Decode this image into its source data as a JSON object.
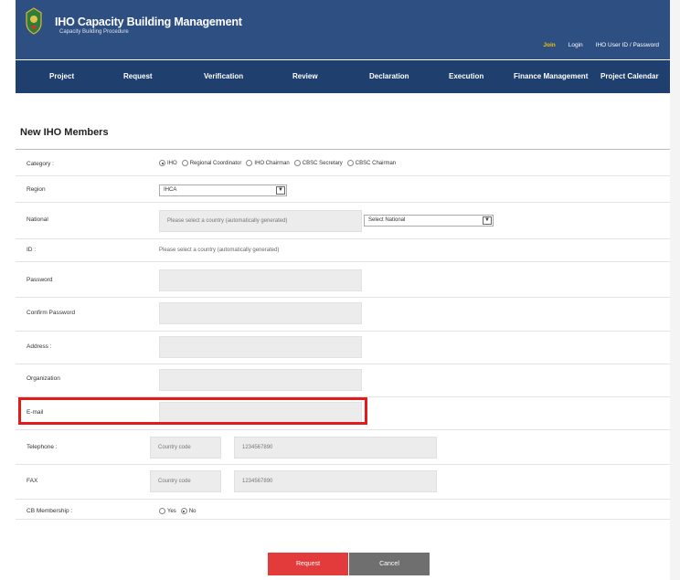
{
  "header": {
    "title": "IHO Capacity Building Management",
    "subtitle": "Capacity Building Procedure",
    "links": [
      "Join",
      "Login",
      "IHO User ID / Password"
    ]
  },
  "nav": {
    "items": [
      "Project",
      "Request",
      "Verification",
      "Review",
      "Declaration",
      "Execution",
      "Finance Management",
      "Project Calendar"
    ]
  },
  "form": {
    "title": "New IHO Members",
    "category": {
      "label": "Category :",
      "options": [
        "IHO",
        "Regional Coordinator",
        "IHO Chairman",
        "CBSC Secretary",
        "CBSC Chairman"
      ],
      "selected": "IHO"
    },
    "region": {
      "label": "Region",
      "value": "IHCA"
    },
    "national": {
      "label": "National",
      "placeholder": "Please select a country (automatically generated)",
      "select": "Select National"
    },
    "id": {
      "label": "ID :",
      "text": "Please select a country (automatically generated)"
    },
    "password": {
      "label": "Password"
    },
    "confirm_password": {
      "label": "Confirm Password"
    },
    "address": {
      "label": "Address :"
    },
    "organization": {
      "label": "Organization"
    },
    "email": {
      "label": "E-mail"
    },
    "telephone": {
      "label": "Telephone :",
      "country_code": "Country code",
      "number": "1234567890"
    },
    "fax": {
      "label": "FAX",
      "country_code": "Country code",
      "number": "1234567890"
    },
    "cb_membership": {
      "label": "CB Membership :",
      "options": [
        "Yes",
        "No"
      ],
      "selected": "No"
    }
  },
  "buttons": {
    "request": "Request",
    "cancel": "Cancel"
  },
  "colors": {
    "header": "#2e4f82",
    "nav": "#1f3f6e",
    "request": "#e33b3b",
    "cancel": "#6f6f6f",
    "highlight": "#e31b1b"
  }
}
